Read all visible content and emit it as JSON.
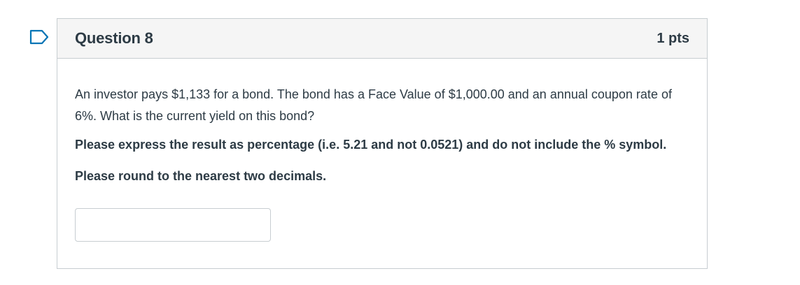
{
  "question": {
    "title": "Question 8",
    "points": "1 pts",
    "text": "An investor pays $1,133 for a bond. The bond has a Face Value of $1,000.00 and an annual coupon rate of 6%. What is the current yield on this bond?",
    "instruction_1": "Please express the result as percentage (i.e. 5.21 and not 0.0521) and do not include the % symbol.",
    "instruction_2": "Please round to the nearest two decimals.",
    "answer_value": ""
  },
  "colors": {
    "flag_outline": "#0374b5",
    "header_background": "#f5f5f5",
    "border": "#c7cdd1",
    "text": "#2d3b45"
  },
  "icons": {
    "flag": "flag-icon"
  }
}
